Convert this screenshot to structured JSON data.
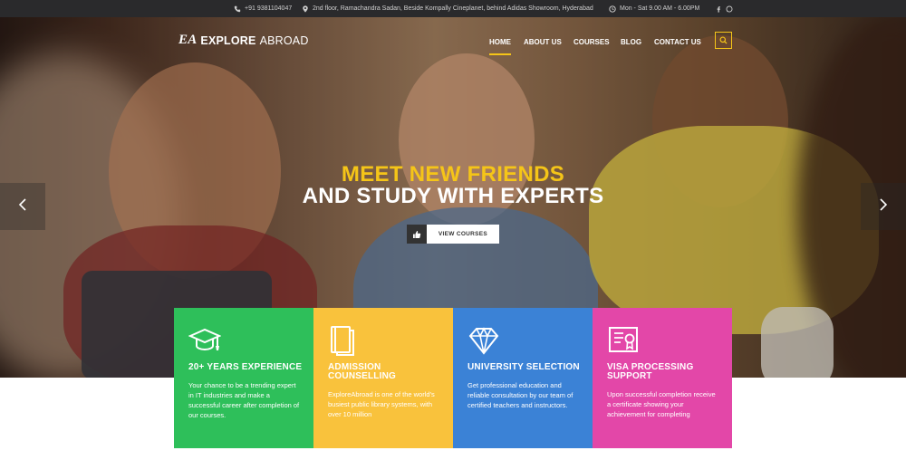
{
  "topbar": {
    "phone": "+91 9381104047",
    "address": "2nd floor, Ramachandra Sadan, Beside Kompally Cineplanet, behind Adidas Showroom, Hyderabad",
    "hours": "Mon - Sat 9.00 AM - 6.00PM",
    "icons": [
      "phone-icon",
      "location-pin-icon",
      "clock-icon",
      "facebook-icon",
      "whatsapp-icon"
    ]
  },
  "logo": {
    "mark": "EA",
    "brand_strong": "EXPLORE",
    "brand_light": "ABROAD"
  },
  "nav": {
    "items": [
      {
        "label": "HOME",
        "active": true
      },
      {
        "label": "ABOUT US",
        "active": false
      },
      {
        "label": "COURSES",
        "active": false
      },
      {
        "label": "BLOG",
        "active": false
      },
      {
        "label": "CONTACT US",
        "active": false
      }
    ],
    "search_icon": "search-icon"
  },
  "hero": {
    "line1": "MEET NEW FRIENDS",
    "line2": "AND STUDY WITH EXPERTS",
    "cta_label": "VIEW COURSES",
    "cta_icon": "thumbs-up-icon",
    "prev_icon": "chevron-left-icon",
    "next_icon": "chevron-right-icon"
  },
  "cards": [
    {
      "icon": "graduation-cap-icon",
      "title": "20+ YEARS EXPERIENCE",
      "text": "Your chance to be a trending expert in IT industries and make a successful career after completion of our courses.",
      "color": "#2ebf5a"
    },
    {
      "icon": "book-icon",
      "title": "ADMISSION COUNSELLING",
      "text": "ExploreAbroad is one of the world's busiest public library systems, with over 10 million",
      "color": "#f9c23c"
    },
    {
      "icon": "diamond-icon",
      "title": "UNIVERSITY SELECTION",
      "text": "Get professional education and reliable consultation by our team of certified teachers and instructors.",
      "color": "#3b82d6"
    },
    {
      "icon": "certificate-icon",
      "title": "VISA PROCESSING SUPPORT",
      "text": "Upon successful completion receive a certificate showing your achievement for completing",
      "color": "#e347a8"
    }
  ],
  "colors": {
    "accent": "#f5c518",
    "topbar_bg": "#2a2a2c"
  }
}
